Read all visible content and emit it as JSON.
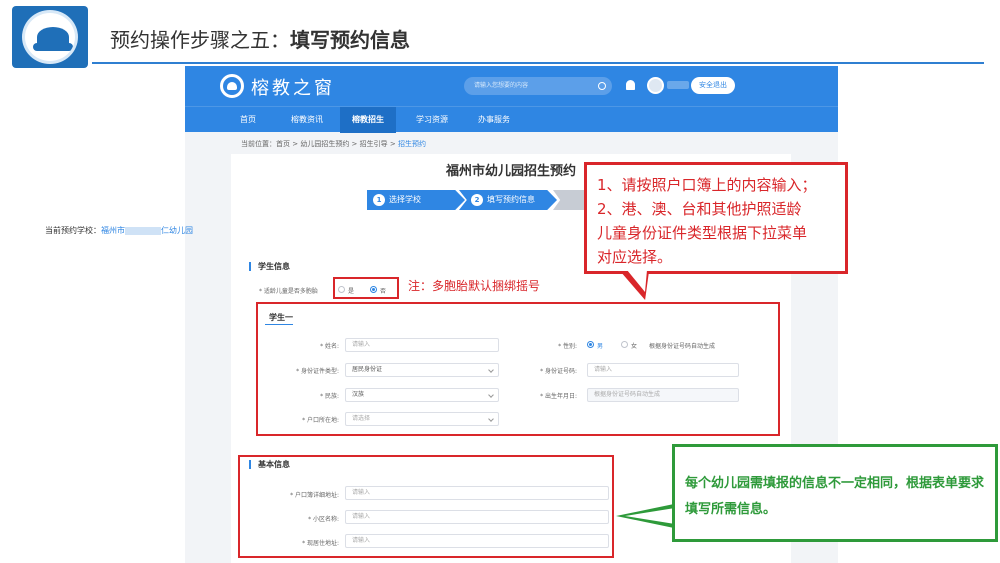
{
  "slide": {
    "title_prefix": "预约操作步骤之五：",
    "title_bold": "填写预约信息"
  },
  "site": {
    "brand": "榕教之窗",
    "search_placeholder": "请输入您想要的内容",
    "logout_label": "安全退出",
    "nav": [
      "首页",
      "榕教资讯",
      "榕教招生",
      "学习资源",
      "办事服务"
    ],
    "active_nav": "榕教招生"
  },
  "breadcrumb": {
    "prefix": "当前位置：",
    "items": [
      "首页",
      "幼儿园招生预约",
      "招生引导"
    ],
    "current": "招生预约",
    "separator": " > "
  },
  "form": {
    "title": "福州市幼儿园招生预约",
    "steps": [
      {
        "num": "1",
        "label": "选择学校"
      },
      {
        "num": "2",
        "label": "填写预约信息"
      }
    ],
    "current_school_label": "当前预约学校：",
    "current_school_prefix": "福州市",
    "current_school_suffix": "仁幼儿园",
    "student_section": "学生信息",
    "multiple_birth_label": "* 适龄儿童是否多胞胎",
    "yes": "是",
    "no": "否",
    "student_one": "学生一",
    "name_label": "* 姓名:",
    "name_placeholder": "请输入",
    "gender_label": "* 性别:",
    "male": "男",
    "female": "女",
    "gender_auto": "根据身份证号码自动生成",
    "id_type_label": "* 身份证件类型:",
    "id_type_value": "居民身份证",
    "id_no_label": "* 身份证号码:",
    "id_no_placeholder": "请输入",
    "ethnicity_label": "* 民族:",
    "ethnicity_value": "汉族",
    "birth_label": "* 出生年月日:",
    "birth_placeholder": "根据身份证号码自动生成",
    "hukou_label": "* 户口所在地:",
    "hukou_placeholder": "请选择",
    "basic_section": "基本信息",
    "hukou_addr_label": "* 户口簿详细地址:",
    "community_label": "* 小区名称:",
    "residence_label": "* 现居住地址:",
    "input_placeholder": "请输入"
  },
  "annotations": {
    "twins_note": "注：多胞胎默认捆绑摇号",
    "red_callout": [
      "1、请按照户口簿上的内容输入；",
      "2、港、澳、台和其他护照适龄",
      "儿童身份证件类型根据下拉菜单",
      "对应选择。"
    ],
    "green_callout": "每个幼儿园需填报的信息不一定相同，根据表单要求填写所需信息。",
    "red_color": "#d9262a",
    "green_color": "#2e9a3a"
  },
  "colors": {
    "brand_blue": "#2f86e3",
    "slide_rule": "#2f7fd1"
  }
}
